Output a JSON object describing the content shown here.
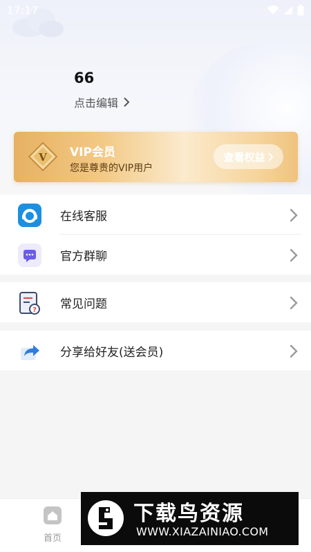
{
  "status_bar": {
    "time": "17:17"
  },
  "profile": {
    "username": "66",
    "edit_label": "点击编辑"
  },
  "vip": {
    "title": "VIP会员",
    "subtitle": "您是尊贵的VIP用户",
    "badge_letter": "V",
    "button_label": "查看权益",
    "accent": "#e7b163"
  },
  "menu_group_1": [
    {
      "label": "在线客服",
      "icon": "headset-icon",
      "icon_bg": "#1d8fe0"
    },
    {
      "label": "官方群聊",
      "icon": "chat-bubble-icon",
      "icon_bg": "#6b5de8"
    }
  ],
  "menu_group_2": [
    {
      "label": "常见问题",
      "icon": "faq-document-icon"
    }
  ],
  "menu_group_3": [
    {
      "label": "分享给好友(送会员)",
      "icon": "share-icon"
    }
  ],
  "bottom_nav": {
    "home_label": "首页"
  },
  "watermark": {
    "title": "下载鸟资源",
    "url": "WWW.XIAZAINIAO.COM"
  }
}
